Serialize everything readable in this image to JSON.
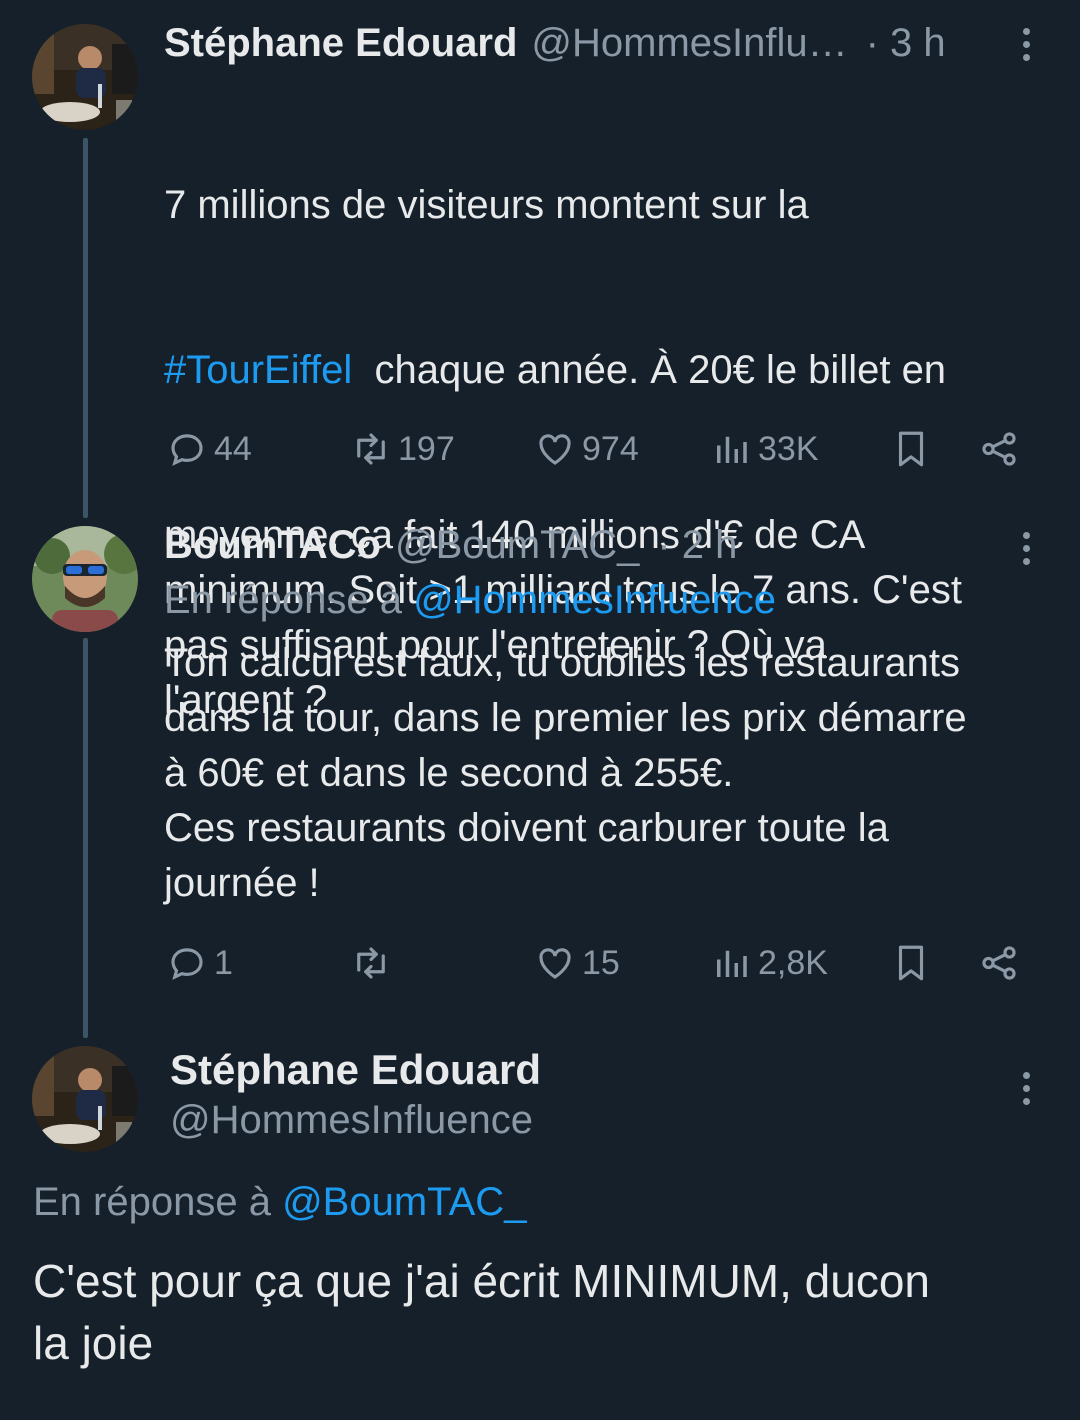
{
  "colors": {
    "background": "#15202b",
    "text": "#e7e9ea",
    "secondary": "#8b98a5",
    "accent": "#1d9bf0"
  },
  "tweet1": {
    "name": "Stéphane Edouard",
    "handle": "@HommesInflu…",
    "time": "· 3 h",
    "text_line1": "7 millions de visiteurs montent sur la",
    "hashtag": "#TourEiffel",
    "text_rest_line2": "  chaque année. À 20€ le billet en",
    "text_rest": "moyenne, ça fait 140 millions d'€ de CA\nminimum. Soit >1 milliard tous le 7 ans. C'est\npas suffisant pour l'entretenir ? Où va\nl'argent ?",
    "replies": "44",
    "retweets": "197",
    "likes": "974",
    "views": "33K",
    "icons": [
      "reply-icon",
      "retweet-icon",
      "like-icon",
      "views-icon",
      "bookmark-icon",
      "share-icon",
      "more-icon"
    ]
  },
  "tweet2": {
    "name": "BoumTACo",
    "handle": "@BoumTAC_",
    "time": "· 2 h",
    "reply_prefix": "En réponse à ",
    "reply_mention": "@HommesInfluence",
    "text": "Ton calcul est faux, tu oublies les restaurants\ndans la tour, dans le premier les prix démarre\nà 60€ et dans le second à 255€.\nCes restaurants doivent carburer toute la\njournée !",
    "replies": "1",
    "retweets": "",
    "likes": "15",
    "views": "2,8K"
  },
  "tweet3": {
    "name": "Stéphane Edouard",
    "handle": "@HommesInfluence",
    "reply_prefix": "En réponse à ",
    "reply_mention": "@BoumTAC_",
    "text": "C'est pour ça que j'ai écrit MINIMUM, ducon\nla joie"
  }
}
